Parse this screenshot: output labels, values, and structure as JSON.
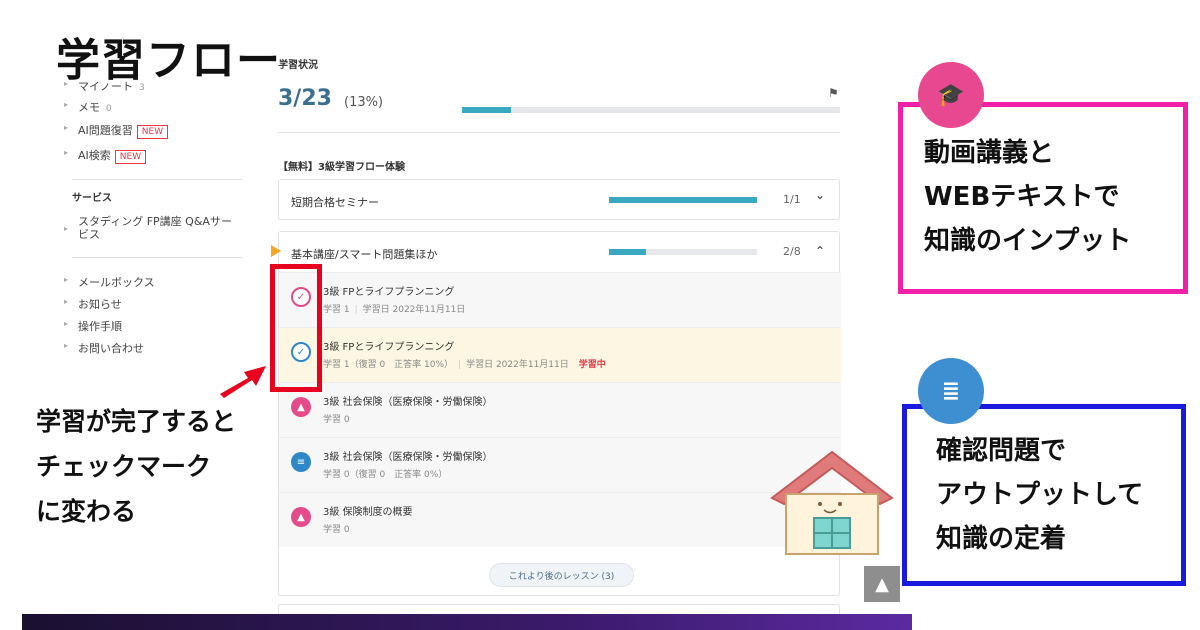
{
  "overlay": {
    "title": "学習フロー",
    "note_lines": [
      "学習が完了すると",
      "チェックマーク",
      "に変わる"
    ],
    "callout_video_lines": [
      "動画講義と",
      "WEBテキストで",
      "知識のインプット"
    ],
    "callout_quiz_lines": [
      "確認問題で",
      "アウトプットして",
      "知識の定着"
    ],
    "colors": {
      "magenta": "#f020a8",
      "blue": "#1a1adf",
      "red": "#e8001f"
    }
  },
  "sidebar": {
    "items_top": [
      {
        "label": "マイノート",
        "count": "3",
        "badge": ""
      },
      {
        "label": "メモ",
        "count": "0",
        "badge": ""
      },
      {
        "label": "AI問題復習",
        "count": "",
        "badge": "NEW"
      },
      {
        "label": "AI検索",
        "count": "",
        "badge": "NEW"
      }
    ],
    "service_heading": "サービス",
    "service_item_line1": "スタディング FP講座 Q&Aサー",
    "service_item_line2": "ビス",
    "items_bottom": [
      "メールボックス",
      "お知らせ",
      "操作手順",
      "お問い合わせ"
    ]
  },
  "main": {
    "status_label": "学習状況",
    "progress_main": "3/23",
    "progress_percent": "(13%)",
    "progress_fraction": 0.13,
    "course_group_label": "【無料】3級学習フロー体験",
    "courses": [
      {
        "title": "短期合格セミナー",
        "count": "1/1",
        "progress": 1.0,
        "chevron": "⌄"
      },
      {
        "title": "基本講座/スマート問題集ほか",
        "count": "2/8",
        "progress": 0.25,
        "chevron": "⌃"
      }
    ],
    "lessons": [
      {
        "title": "3級 FPとライフプランニング",
        "meta1": "学習 1",
        "meta2": "学習日 2022年11月11日",
        "status": "",
        "icon": "check-icon"
      },
      {
        "title": "3級 FPとライフプランニング",
        "meta1": "学習 1（復習 0　正答率 10%）",
        "meta2": "学習日 2022年11月11日",
        "status": "学習中",
        "icon": "check-icon"
      },
      {
        "title": "3級 社会保険（医療保険・労働保険）",
        "meta1": "学習 0",
        "meta2": "",
        "status": "",
        "icon": "graduation-cap-icon"
      },
      {
        "title": "3級 社会保険（医療保険・労働保険）",
        "meta1": "学習 0（復習 0　正答率 0%）",
        "meta2": "",
        "status": "",
        "icon": "document-icon"
      },
      {
        "title": "3級 保険制度の概要",
        "meta1": "学習 0",
        "meta2": "",
        "status": "",
        "icon": "graduation-cap-icon"
      }
    ],
    "later_lessons_button": "これより後のレッスン (3)"
  }
}
